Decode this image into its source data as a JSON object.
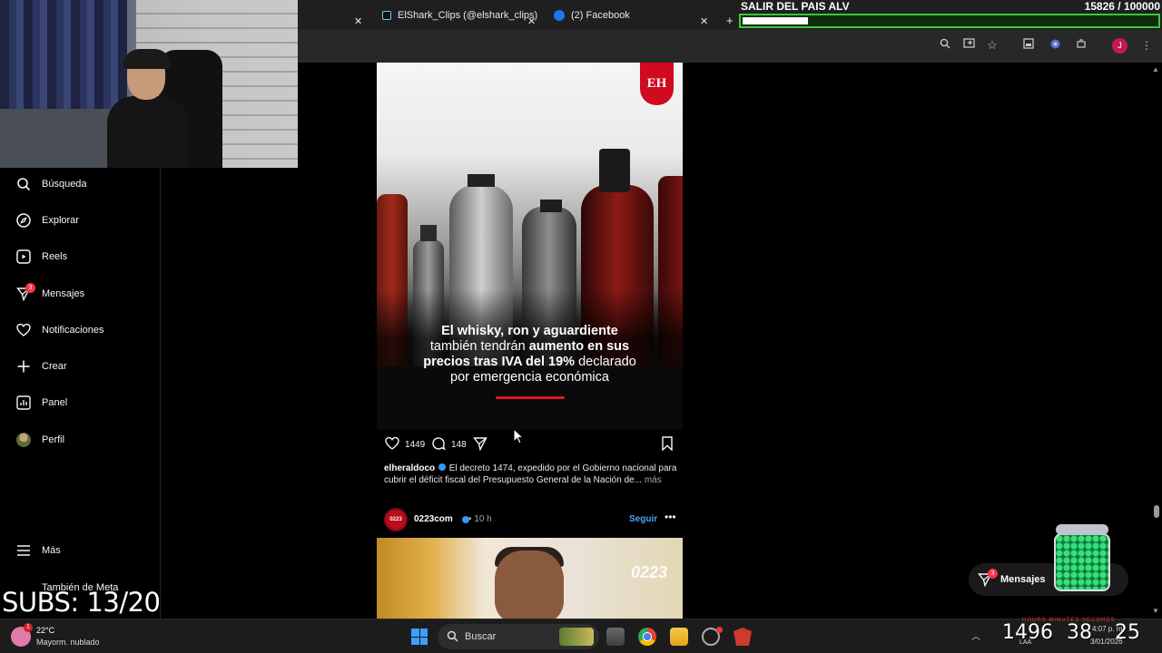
{
  "browser": {
    "tabs": [
      {
        "label": "ElShark_Clips (@elshark_clips)",
        "icon": "tiktok-icon"
      },
      {
        "label": "(2) Facebook",
        "icon": "facebook-icon"
      }
    ],
    "new_tab": "+",
    "toolbar_icons": [
      "zoom-icon",
      "cast-icon",
      "star-icon",
      "sidebar-icon",
      "ai-icon",
      "extensions-icon",
      "profile-icon",
      "menu-icon"
    ],
    "profile_initial": "J"
  },
  "goal": {
    "title": "SALIR DEL PAIS ALV",
    "count": "15826 / 100000",
    "progress": 0.158
  },
  "sidebar": {
    "items": [
      {
        "label": "Búsqueda",
        "icon": "search-icon"
      },
      {
        "label": "Explorar",
        "icon": "compass-icon"
      },
      {
        "label": "Reels",
        "icon": "reels-icon"
      },
      {
        "label": "Mensajes",
        "icon": "messenger-icon",
        "badge": "3"
      },
      {
        "label": "Notificaciones",
        "icon": "heart-icon"
      },
      {
        "label": "Crear",
        "icon": "plus-icon"
      },
      {
        "label": "Panel",
        "icon": "panel-icon"
      },
      {
        "label": "Perfil",
        "icon": "avatar-icon"
      },
      {
        "label": "Más",
        "icon": "hamburger-icon"
      }
    ],
    "also_meta": "También de Meta"
  },
  "post1": {
    "image_logo": "EH",
    "image_text_parts": {
      "l1_bold": "El whisky, ron y aguardiente",
      "l2_normal": "también tendrán ",
      "l2_bold": "aumento en sus",
      "l3_bold": "precios tras IVA del 19%",
      "l3_normal": " declarado",
      "l4_normal": "por emergencia económica"
    },
    "likes": "1449",
    "comments": "148",
    "username": "elheraldoco",
    "caption": " El decreto 1474, expedido por el Gobierno nacional para cubrir el déficit fiscal del Presupuesto General de la Nación de...",
    "more": " más"
  },
  "post2": {
    "avatar_text": "0223",
    "username": "0223com",
    "time": "• 10 h",
    "follow": "Seguir",
    "more": "•••",
    "image_logo": "0223"
  },
  "floating_messages": {
    "label": "Mensajes",
    "badge": "3"
  },
  "overlay": {
    "subs": "SUBS: 13/20"
  },
  "taskbar": {
    "temp": "22°C",
    "weather": "Mayorm. nublado",
    "weather_badge": "1",
    "search": "Buscar",
    "timer_hours": "1496",
    "timer_minutes": "38",
    "timer_seconds": "25",
    "timer_labels": "HOURS  MINUTES  SECONDS",
    "clock_time": "4:07 p. m.",
    "clock_date": "3/01/2026",
    "lang": "LAA"
  },
  "colors": {
    "accent_blue": "#4aa3f0",
    "badge_red": "#ff3040",
    "goal_green": "#3fc43f"
  }
}
